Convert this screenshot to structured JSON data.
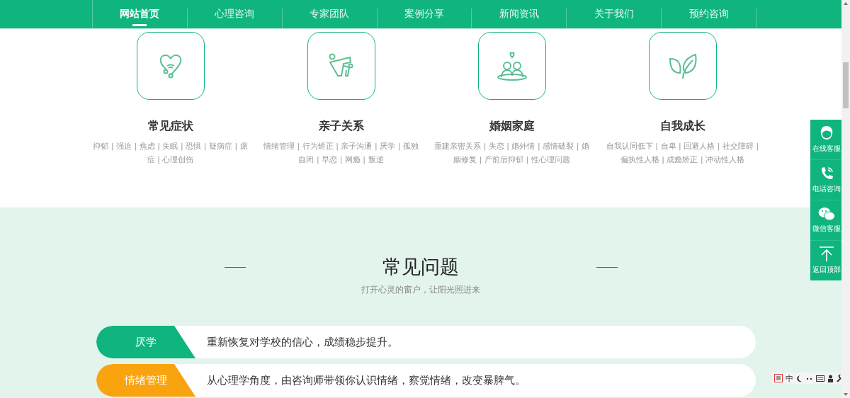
{
  "nav": {
    "items": [
      {
        "label": "网站首页",
        "selected": true
      },
      {
        "label": "心理咨询",
        "selected": false
      },
      {
        "label": "专家团队",
        "selected": false
      },
      {
        "label": "案例分享",
        "selected": false
      },
      {
        "label": "新闻资讯",
        "selected": false
      },
      {
        "label": "关于我们",
        "selected": false
      },
      {
        "label": "预约咨询",
        "selected": false
      }
    ]
  },
  "categories": [
    {
      "title": "常见症状",
      "tags": "抑郁 | 强迫 | 焦虑 | 失眠 | 恐惧 | 疑病症 | 癔症 | 心理创伤"
    },
    {
      "title": "亲子关系",
      "tags": "情绪管理 | 行为矫正 | 亲子沟通 | 厌学 | 孤独自闭 | 早恋 | 网瘾 | 叛逆"
    },
    {
      "title": "婚姻家庭",
      "tags": "重建亲密关系 | 失恋 | 婚外情 | 感情破裂 | 婚姻修复 | 产前后抑郁 | 性心理问题"
    },
    {
      "title": "自我成长",
      "tags": "自我认同低下 | 自卑 | 回避人格 | 社交障碍 | 偏执性人格 | 成瘾矫正 | 冲动性人格"
    }
  ],
  "faq": {
    "title": "常见问题",
    "subtitle": "打开心灵的窗户，让阳光照进来",
    "items": [
      {
        "label": "厌学",
        "text": "重新恢复对学校的信心，成绩稳步提升。",
        "color": "#10b47f"
      },
      {
        "label": "情绪管理",
        "text": "从心理学角度，由咨询师带领你认识情绪，察觉情绪，改变暴脾气。",
        "color": "#f9a30f"
      }
    ]
  },
  "side_tools": [
    {
      "label": "在线客服"
    },
    {
      "label": "电话咨询"
    },
    {
      "label": "微信客服"
    },
    {
      "label": "返回顶部"
    }
  ],
  "ime_toolbar": {
    "mode": "中"
  }
}
